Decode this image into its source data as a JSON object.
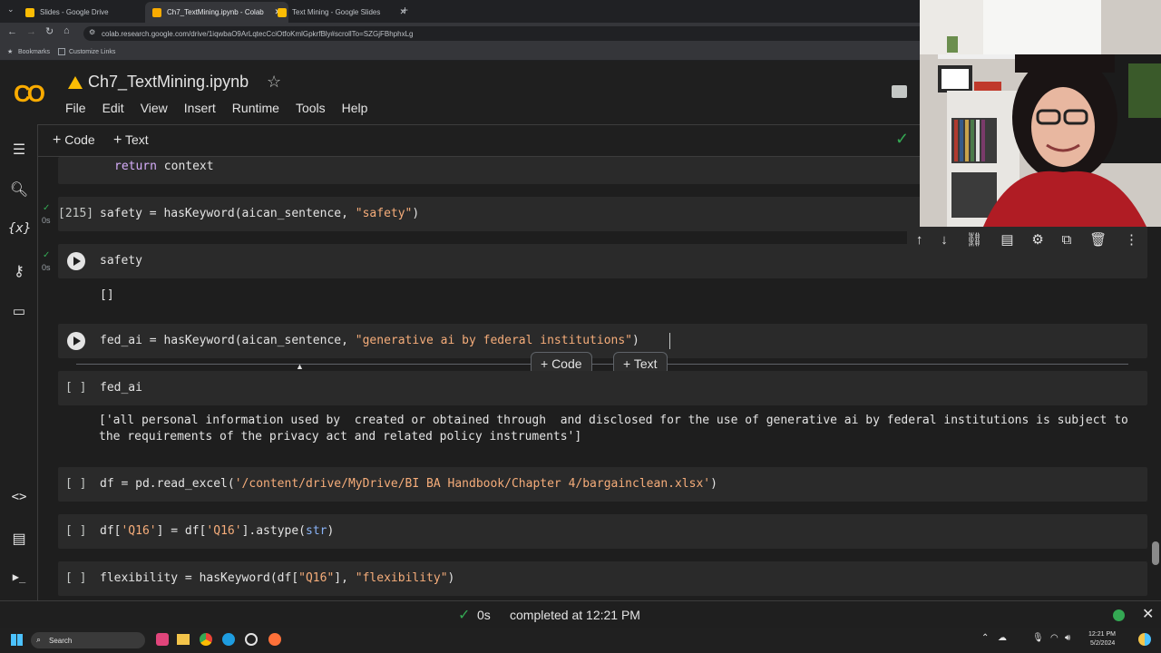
{
  "browser": {
    "tabs": [
      {
        "title": "Slides - Google Drive",
        "active": false,
        "color": "#fbbc04"
      },
      {
        "title": "Ch7_TextMining.ipynb - Colab",
        "active": true,
        "color": "#f9ab00"
      },
      {
        "title": "Text Mining - Google Slides",
        "active": false,
        "color": "#fbbc04"
      }
    ],
    "url": "colab.research.google.com/drive/1iqwbaO9ArLqtecCciOtfoKmlGpkrfBly#scrollTo=SZGjFBhphxLg",
    "bookmarks": [
      "Bookmarks",
      "Customize Links"
    ]
  },
  "colab": {
    "logo": "CO",
    "notebook_title": "Ch7_TextMining.ipynb",
    "menu": [
      "File",
      "Edit",
      "View",
      "Insert",
      "Runtime",
      "Tools",
      "Help"
    ],
    "toolbar": {
      "add_code": "Code",
      "add_text": "Text"
    },
    "accent": "#f9ab00"
  },
  "sidebar_icons": [
    "toc-icon",
    "search-icon",
    "variables-icon",
    "key-icon",
    "folder-icon",
    "code-snippets-icon",
    "command-palette-icon",
    "terminal-icon"
  ],
  "cells": {
    "return_line": {
      "kw": "return",
      "rest": " context"
    },
    "c215": {
      "prompt": "[215]",
      "exec_time": "0s",
      "code_a": "safety = hasKeyword(aican_sentence, ",
      "code_str": "\"safety\"",
      "code_b": ")"
    },
    "c_safety": {
      "exec_time": "0s",
      "code": "safety",
      "output": "[]"
    },
    "c_fed": {
      "code_a": "fed_ai = hasKeyword(aican_sentence, ",
      "code_str": "\"generative ai by federal institutions\"",
      "code_b": ")"
    },
    "hover": {
      "code": "+ Code",
      "text": "+ Text"
    },
    "c_fedai": {
      "prompt": "[ ]",
      "code": "fed_ai",
      "output_line1": "['all personal information used by  created or obtained through  and disclosed for the use of generative ai by federal institutions is subject to",
      "output_line2": "the requirements of the privacy act and related policy instruments']"
    },
    "c_df": {
      "prompt": "[ ]",
      "code_a": "df = pd.read_excel(",
      "code_str": "'/content/drive/MyDrive/BI BA Handbook/Chapter 4/bargainclean.xlsx'",
      "code_b": ")"
    },
    "c_q16": {
      "prompt": "[ ]",
      "code_a": "df[",
      "s1": "'Q16'",
      "code_b": "] = df[",
      "s2": "'Q16'",
      "code_c": "].astype(",
      "code_d": "str",
      "code_e": ")"
    },
    "c_flex": {
      "prompt": "[ ]",
      "code_a": "flexibility = hasKeyword(df[",
      "s1": "\"Q16\"",
      "code_b": "], ",
      "s2": "\"flexibility\"",
      "code_c": ")"
    }
  },
  "status": {
    "exec_time": "0s",
    "text": "completed at 12:21 PM"
  },
  "taskbar": {
    "search": "Search",
    "time": "12:21 PM",
    "date": "5/2/2024"
  }
}
